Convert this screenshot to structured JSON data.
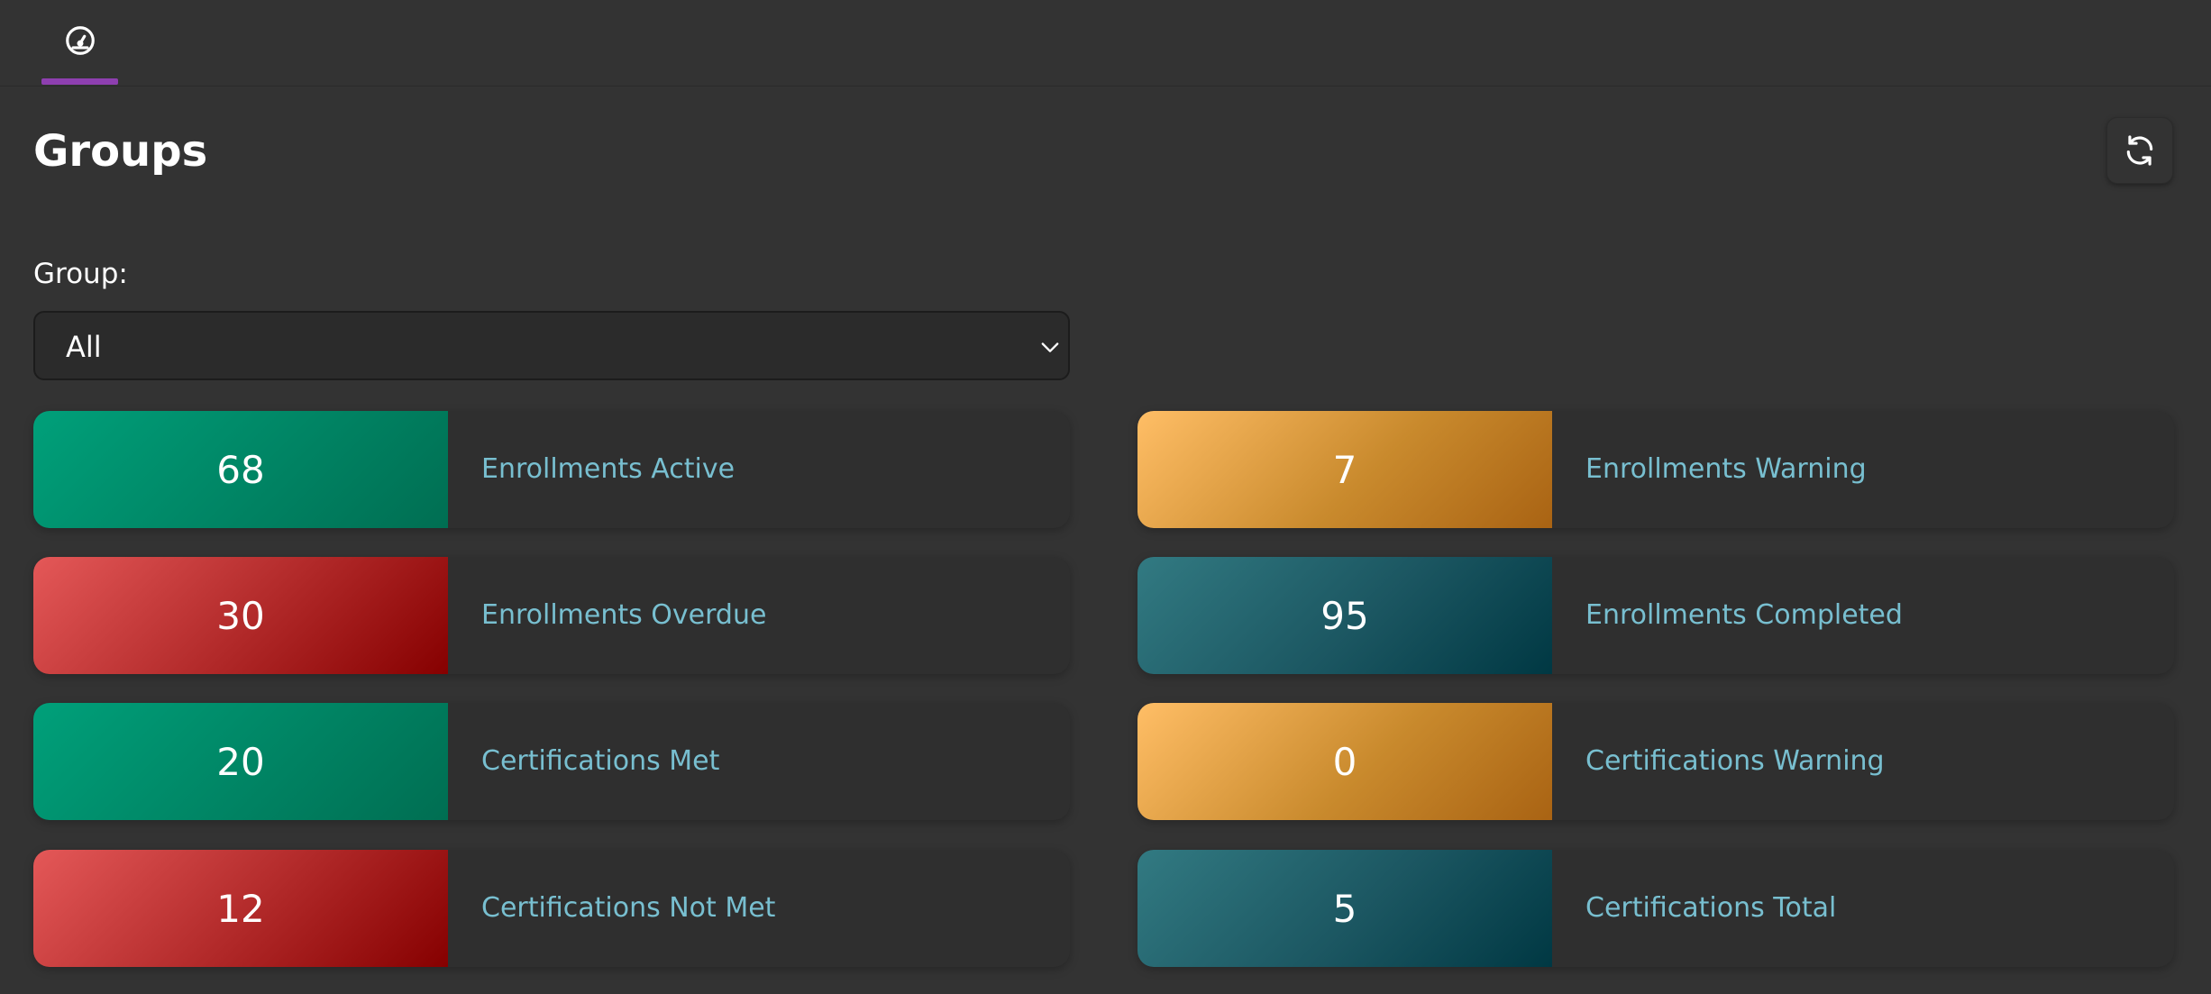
{
  "nav": {
    "tabs": [
      {
        "icon": "dashboard-gauge-icon",
        "active": true
      }
    ],
    "accent_color": "#8e3fb0"
  },
  "page": {
    "title": "Groups",
    "refresh_icon": "refresh-icon"
  },
  "filter": {
    "label": "Group:",
    "selected": "All"
  },
  "stats": [
    {
      "value": "68",
      "label": "Enrollments Active",
      "color": "green"
    },
    {
      "value": "7",
      "label": "Enrollments Warning",
      "color": "orange"
    },
    {
      "value": "30",
      "label": "Enrollments Overdue",
      "color": "red"
    },
    {
      "value": "95",
      "label": "Enrollments Completed",
      "color": "teal"
    },
    {
      "value": "20",
      "label": "Certifications Met",
      "color": "green"
    },
    {
      "value": "0",
      "label": "Certifications Warning",
      "color": "orange"
    },
    {
      "value": "12",
      "label": "Certifications Not Met",
      "color": "red"
    },
    {
      "value": "5",
      "label": "Certifications Total",
      "color": "teal"
    }
  ],
  "colors": {
    "green": "#00a07a",
    "orange": "#ffbe66",
    "red": "#e45858",
    "teal": "#327a82",
    "label_text": "#78bfd0",
    "background": "#333333"
  }
}
